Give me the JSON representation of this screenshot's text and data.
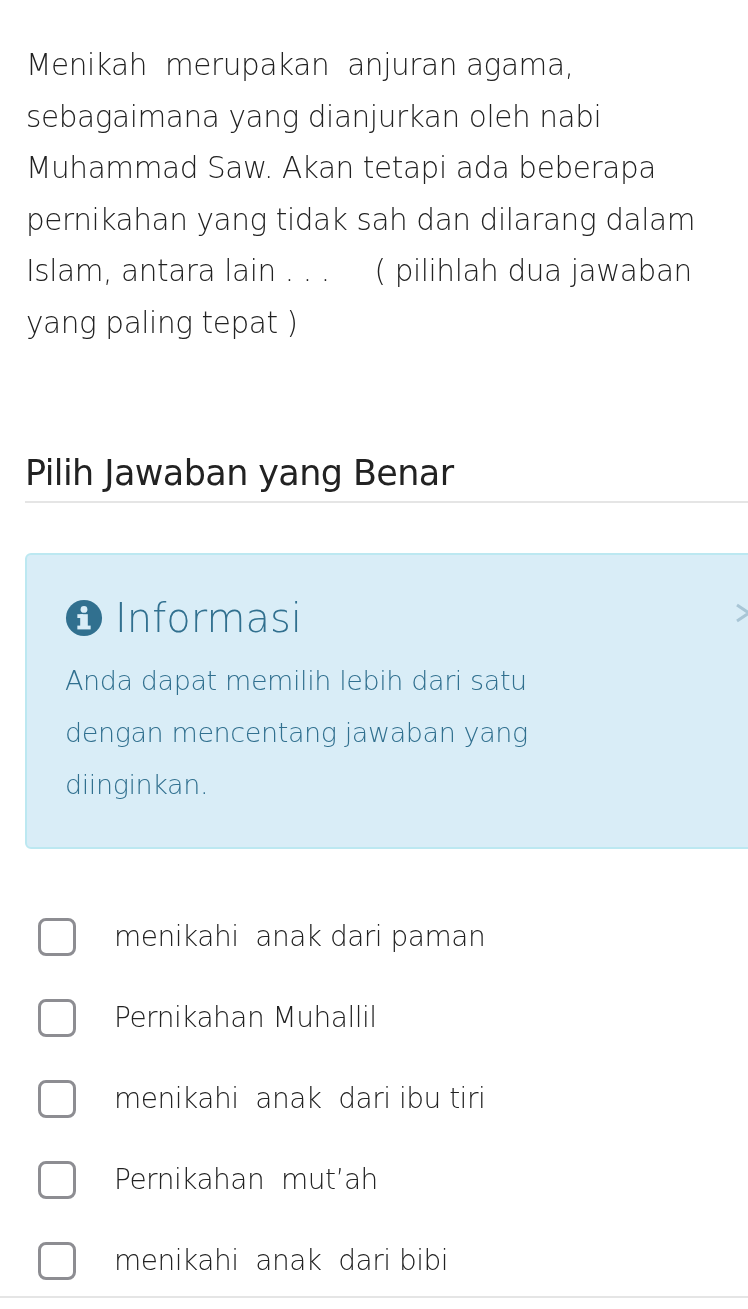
{
  "question": "Menikah  merupakan  anjuran agama, sebagaimana yang dianjurkan oleh nabi Muhammad Saw. Akan tetapi ada beberapa pernikahan yang tidak sah dan dilarang dalam Islam, antara lain . . .     ( pilihlah dua jawaban yang paling tepat )",
  "heading": "Pilih Jawaban yang Benar",
  "info": {
    "title": "Informasi",
    "text": "Anda dapat memilih lebih dari satu dengan mencentang jawaban yang diinginkan."
  },
  "options": [
    {
      "label": "menikahi  anak dari paman",
      "checked": false
    },
    {
      "label": "Pernikahan Muhallil",
      "checked": false
    },
    {
      "label": "menikahi  anak  dari ibu tiri",
      "checked": false
    },
    {
      "label": "Pernikahan  mut’ah",
      "checked": false
    },
    {
      "label": "menikahi  anak  dari bibi",
      "checked": false
    }
  ]
}
